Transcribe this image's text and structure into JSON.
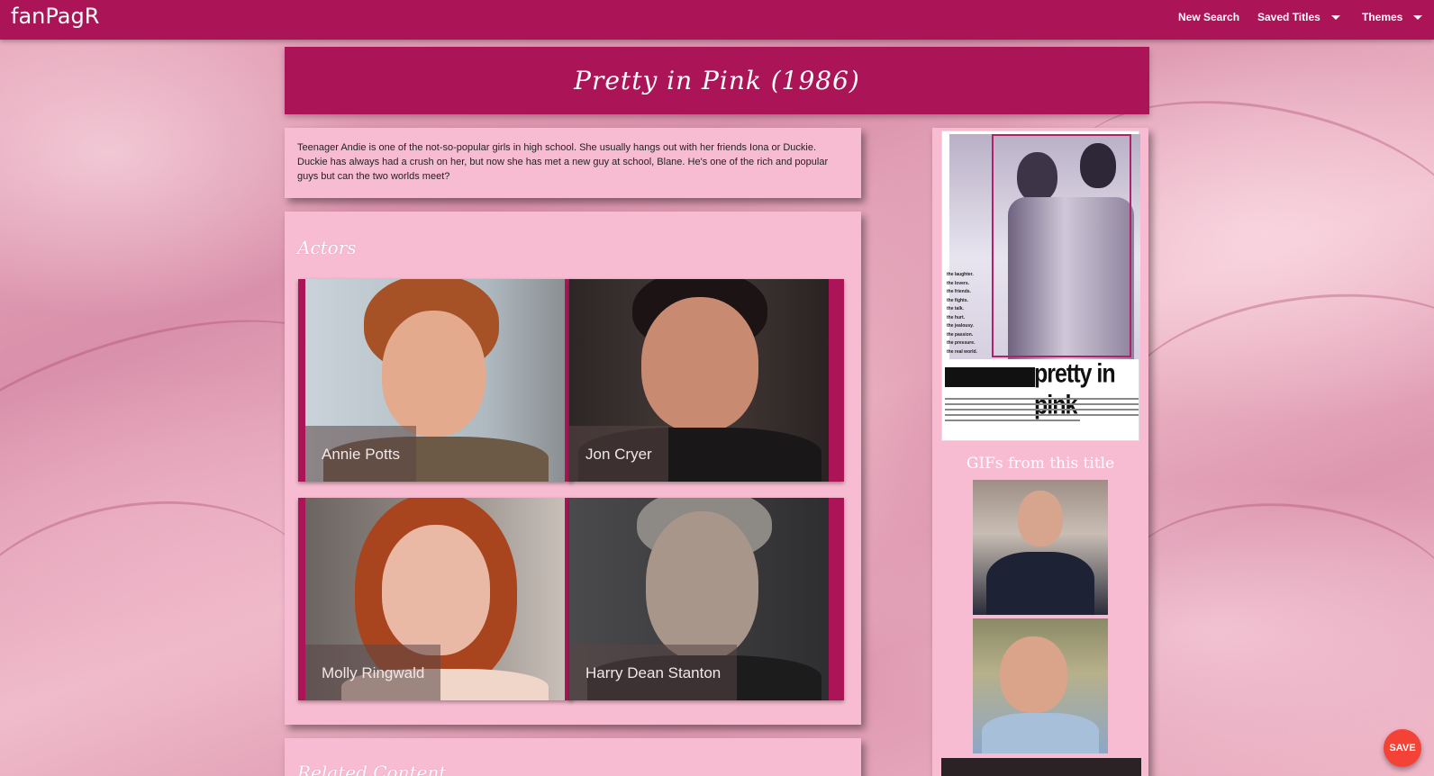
{
  "navbar": {
    "brand": "fanPagR",
    "new_search": "New Search",
    "saved_titles": "Saved Titles",
    "themes": "Themes",
    "color": "#ab1557"
  },
  "title": "Pretty in Pink (1986)",
  "description": "Teenager Andie is one of the not-so-popular girls in high school. She usually hangs out with her friends Iona or Duckie. Duckie has always had a crush on her, but now she has met a new guy at school, Blane. He's one of the rich and popular guys but can the two worlds meet?",
  "actors_heading": "Actors",
  "actors": [
    {
      "name": "Annie Potts"
    },
    {
      "name": "Jon Cryer"
    },
    {
      "name": "Molly Ringwald"
    },
    {
      "name": "Harry Dean Stanton"
    }
  ],
  "related_heading": "Related Content",
  "poster": {
    "title_text": "pretty in pink",
    "tagline": [
      "the laughter.",
      "the lovers.",
      "the friends.",
      "the fights.",
      "the talk.",
      "the hurt.",
      "the jealousy.",
      "the passion.",
      "the pressure.",
      "the real world."
    ]
  },
  "gifs_heading": "GIFs from this title",
  "save_button": "SAVE",
  "theme": {
    "card": "#f7bcd1",
    "accent": "#ab1557",
    "fab": "#f44336"
  }
}
